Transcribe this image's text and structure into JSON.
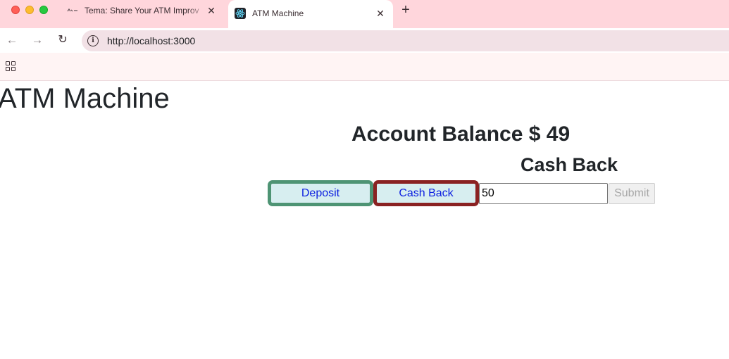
{
  "browser": {
    "tabs": [
      {
        "title": "Tema: Share Your ATM Improv",
        "icon": "forum-favicon-icon",
        "close": "✕",
        "active": false
      },
      {
        "title": "ATM Machine",
        "icon": "react-logo-icon",
        "close": "✕",
        "active": true
      }
    ],
    "new_tab": "+",
    "nav": {
      "back": "←",
      "forward": "→",
      "reload": "↻"
    },
    "address": {
      "url": "http://localhost:3000",
      "info_icon": "i"
    },
    "bookmarks_icon": "apps-grid-icon"
  },
  "page": {
    "title": "ATM Machine",
    "balance_text": "Account Balance $ 49",
    "mode_label": "Cash Back",
    "buttons": {
      "deposit": "Deposit",
      "cash_back": "Cash Back",
      "submit": "Submit"
    },
    "amount_value": "50",
    "submit_disabled": true
  },
  "colors": {
    "tabbar_bg": "#ffd6dc",
    "deposit_border": "#4e9474",
    "cashback_border": "#8a2222",
    "mode_button_bg": "#d7eef0",
    "button_text": "#0b1ee0"
  }
}
